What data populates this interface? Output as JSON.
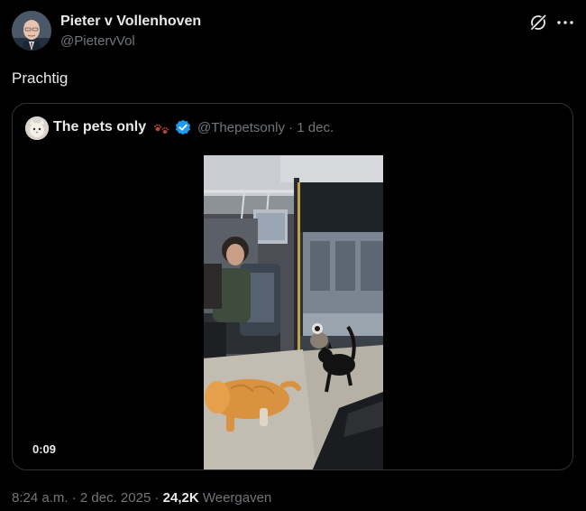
{
  "tweet": {
    "author_name": "Pieter v Vollenhoven",
    "author_handle": "@PietervVol",
    "text": "Prachtig",
    "grok_icon": "grok-icon",
    "more_icon": "more-horizontal-icon"
  },
  "quote": {
    "name": "The pets only",
    "emoji": "🐾",
    "handle": "@Thepetsonly",
    "separator": " · ",
    "date": "1 dec.",
    "verified_color": "#1d9bf0",
    "video_duration": "0:09"
  },
  "footer": {
    "time": "8:24 a.m.",
    "separator": " · ",
    "date": "2 dec. 2025",
    "separator2": " · ",
    "views_count": "24,2K",
    "views_label": "Weergaven"
  },
  "colors": {
    "background": "#000000",
    "text_primary": "#e7e9ea",
    "text_secondary": "#71767b",
    "border": "#2f3336"
  }
}
